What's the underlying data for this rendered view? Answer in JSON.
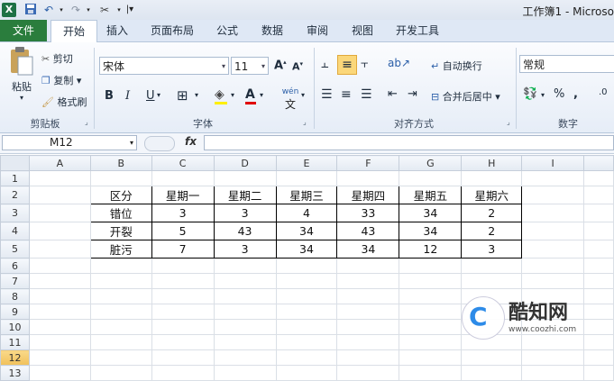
{
  "window": {
    "title": "工作簿1 - Microso"
  },
  "quick_access": {
    "save_icon": "save-icon",
    "undo_icon": "undo-icon",
    "redo_icon": "redo-icon"
  },
  "tabs": [
    "文件",
    "开始",
    "插入",
    "页面布局",
    "公式",
    "数据",
    "审阅",
    "视图",
    "开发工具"
  ],
  "clipboard": {
    "paste": "粘贴",
    "cut": "剪切",
    "copy": "复制",
    "format_painter": "格式刷",
    "group": "剪贴板"
  },
  "font": {
    "name": "宋体",
    "size": "11",
    "bold": "B",
    "italic": "I",
    "underline": "U",
    "font_color_letter": "A",
    "group": "字体",
    "phonetic": "wén"
  },
  "alignment": {
    "wrap_text": "自动换行",
    "merge_center": "合并后居中",
    "group": "对齐方式"
  },
  "number": {
    "format": "常规",
    "percent": "%",
    "group": "数字"
  },
  "formula_bar": {
    "name_box": "M12",
    "fx": "fx",
    "value": ""
  },
  "columns": [
    "A",
    "B",
    "C",
    "D",
    "E",
    "F",
    "G",
    "H",
    "I"
  ],
  "rows": [
    "1",
    "2",
    "3",
    "4",
    "5",
    "6",
    "7",
    "8",
    "9",
    "10",
    "11",
    "12",
    "13"
  ],
  "table": {
    "header": [
      "区分",
      "星期一",
      "星期二",
      "星期三",
      "星期四",
      "星期五",
      "星期六"
    ],
    "rows": [
      [
        "错位",
        "3",
        "3",
        "4",
        "33",
        "34",
        "2"
      ],
      [
        "开裂",
        "5",
        "43",
        "34",
        "43",
        "34",
        "2"
      ],
      [
        "脏污",
        "7",
        "3",
        "34",
        "34",
        "12",
        "3"
      ]
    ]
  },
  "watermark": {
    "brand": "酷知网",
    "url": "www.coozhi.com"
  }
}
